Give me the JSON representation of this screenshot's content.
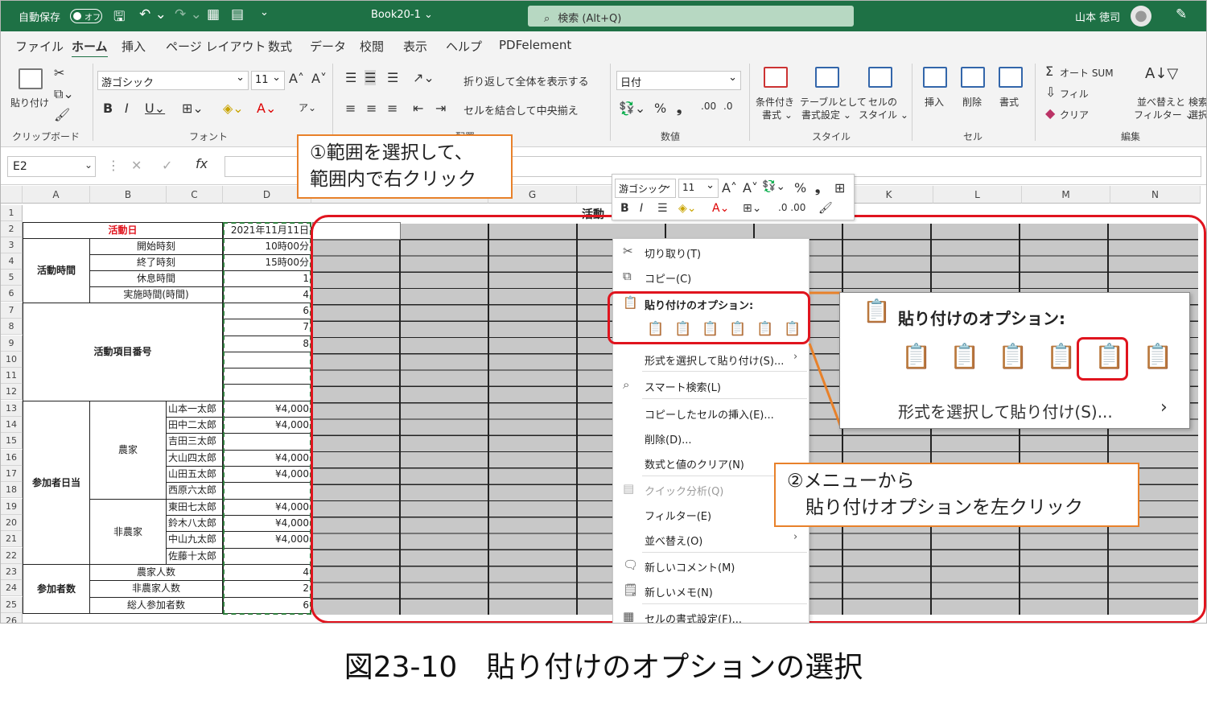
{
  "titlebar": {
    "autosave": "自動保存",
    "toggle": "オフ",
    "filename": "Book20-1 ⌄",
    "search": "検索 (Alt+Q)",
    "user": "山本 徳司"
  },
  "tabs": [
    "ファイル",
    "ホーム",
    "挿入",
    "ページ レイアウト",
    "数式",
    "データ",
    "校閲",
    "表示",
    "ヘルプ",
    "PDFelement"
  ],
  "ribbon": {
    "paste": "貼り付け",
    "clipboard": "クリップボード",
    "font_name": "游ゴシック",
    "font_size": "11",
    "font": "フォント",
    "wrap": "折り返して全体を表示する",
    "merge": "セルを結合して中央揃え",
    "align": "配置",
    "numfmt": "日付",
    "number": "数値",
    "cond1": "条件付き",
    "cond2": "書式 ⌄",
    "table1": "テーブルとして",
    "table2": "書式設定 ⌄",
    "cellstyle1": "セルの",
    "cellstyle2": "スタイル ⌄",
    "style": "スタイル",
    "insert": "挿入",
    "delete": "削除",
    "format": "書式",
    "cells": "セル",
    "autosum": "オート SUM",
    "fill": "フィル",
    "clear": "クリア",
    "sort1": "並べ替えと",
    "sort2": "フィルター ⌄",
    "find1": "検索",
    "find2": "選択",
    "editing": "編集"
  },
  "formula": {
    "namebox": "E2"
  },
  "grid": {
    "columns": [
      "A",
      "B",
      "C",
      "D",
      "G",
      "K",
      "L",
      "M",
      "N"
    ],
    "rows": [
      "1",
      "2",
      "3",
      "4",
      "5",
      "6",
      "7",
      "8",
      "9",
      "10",
      "11",
      "12",
      "13",
      "14",
      "15",
      "16",
      "17",
      "18",
      "19",
      "20",
      "21",
      "22",
      "23",
      "24",
      "25",
      "26"
    ],
    "title_fragment": "活動",
    "activity_day": "活動日",
    "date": "2021年11月11日",
    "activity_time": "活動時間",
    "start": "開始時刻",
    "start_v": "10時00分",
    "end": "終了時刻",
    "end_v": "15時00分",
    "rest": "休息時間",
    "rest_v": "1",
    "work": "実施時間(時間)",
    "work_v": "4",
    "item_no": "活動項目番号",
    "n6": "6",
    "n7": "7",
    "n8": "8",
    "daily": "参加者日当",
    "farmer": "農家",
    "nonfarmer": "非農家",
    "names": [
      "山本一太郎",
      "田中二太郎",
      "吉田三太郎",
      "大山四太郎",
      "山田五太郎",
      "西原六太郎",
      "東田七太郎",
      "鈴木八太郎",
      "中山九太郎",
      "佐藤十太郎"
    ],
    "amounts": [
      "¥4,000",
      "¥4,000",
      "",
      "¥4,000",
      "¥4,000",
      "",
      "¥4,000",
      "¥4,000",
      "¥4,000",
      ""
    ],
    "participants": "参加者数",
    "farm_cnt": "農家人数",
    "farm_cnt_v": "4",
    "nonfarm_cnt": "非農家人数",
    "nonfarm_cnt_v": "2",
    "total_cnt": "総人参加者数",
    "total_cnt_v": "6"
  },
  "mini": {
    "font": "游ゴシック",
    "size": "11"
  },
  "menu": {
    "cut": "切り取り(T)",
    "copy": "コピー(C)",
    "paste_opts": "貼り付けのオプション:",
    "paste_special": "形式を選択して貼り付け(S)...",
    "smart": "スマート検索(L)",
    "insert_copied": "コピーしたセルの挿入(E)...",
    "delete": "削除(D)...",
    "clear": "数式と値のクリア(N)",
    "quick": "クイック分析(Q)",
    "filter": "フィルター(E)",
    "sort": "並べ替え(O)",
    "comment": "新しいコメント(M)",
    "note": "新しいメモ(N)",
    "format": "セルの書式設定(F)..."
  },
  "zoom": {
    "title": "貼り付けのオプション:",
    "special": "形式を選択して貼り付け(S)..."
  },
  "callout1": "①範囲を選択して、\n範囲内で右クリック",
  "callout2": "②メニューから\n　貼り付けオプションを左クリック",
  "caption": "図23-10　貼り付けのオプションの選択"
}
